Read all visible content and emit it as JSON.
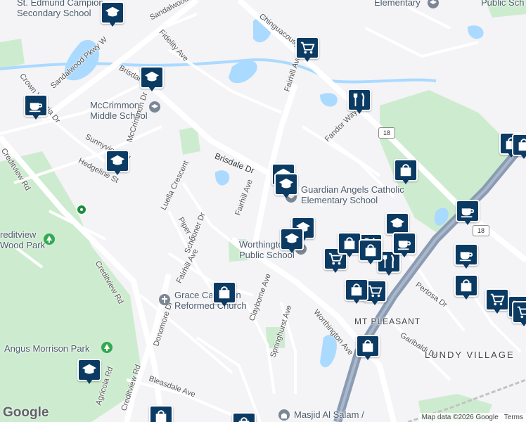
{
  "map": {
    "attribution": "Map data ©2026 Google",
    "links": [
      "Terms"
    ],
    "logo": "Google",
    "colors": {
      "background": "#f4f3f6",
      "park": "#cdeccf",
      "water": "#aadaff",
      "highway": "#8a9bb2",
      "marker": "#0b3a63"
    },
    "places": [
      {
        "text": "McCrimmon Middle School",
        "lines": [
          "McCrimmon",
          "Middle School"
        ]
      },
      {
        "text": "Guardian Angels Catholic Elementary School",
        "lines": [
          "Guardian Angels Catholic",
          "Elementary School"
        ]
      },
      {
        "text": "Worthington Public School",
        "lines": [
          "Worthington",
          "Public School"
        ]
      },
      {
        "text": "Grace Canadian Reformed Church",
        "lines": [
          "Grace Canadian",
          "Reformed Church"
        ]
      },
      {
        "text": "Angus Morrison Park",
        "lines": [
          "Angus Morrison Park"
        ]
      },
      {
        "text": "Creditview Wood Park",
        "lines": [
          "reditview",
          "Wood Park"
        ]
      },
      {
        "text": "St. Edmund Campion Secondary School",
        "lines": [
          "St. Edmund Campion",
          "Secondary School"
        ]
      },
      {
        "text": "Elementary",
        "lines": [
          "Elementary"
        ]
      },
      {
        "text": "Public Sch",
        "lines": [
          "Public Sch"
        ]
      },
      {
        "text": "Masjid Al Salam",
        "lines": [
          "Masjid Al Salam /"
        ]
      }
    ],
    "roads": [
      "Sandalwood Pkwy W",
      "Sandalwood",
      "Brisdale",
      "Brisdale Dr",
      "Chinguacousy Rd",
      "Fidelity Ave",
      "Crown Victoria Dr",
      "Sunnyview Rd",
      "McCrimmon Dr",
      "Hedgeline St",
      "Creditview Rd",
      "Luella Crescent",
      "Piper St",
      "Schooner Dr",
      "Fairhill Ave",
      "Fandor Way",
      "Claybome Ave",
      "Springhurst Ave",
      "Worthington Ave",
      "Donomore Dr",
      "Bleasdale Ave",
      "Agricola Rd",
      "Pertosa Dr",
      "Garibaldi Dr"
    ],
    "neighbourhoods": [
      "MT PLEASANT",
      "LUNDY VILLAGE"
    ],
    "highway_shields": [
      "18",
      "18"
    ],
    "markers": [
      {
        "type": "school"
      },
      {
        "type": "school"
      },
      {
        "type": "school"
      },
      {
        "type": "school"
      },
      {
        "type": "school"
      },
      {
        "type": "school"
      },
      {
        "type": "school"
      },
      {
        "type": "school"
      },
      {
        "type": "school"
      },
      {
        "type": "grocery"
      },
      {
        "type": "grocery"
      },
      {
        "type": "grocery"
      },
      {
        "type": "grocery"
      },
      {
        "type": "grocery"
      },
      {
        "type": "grocery"
      },
      {
        "type": "restaurant"
      },
      {
        "type": "restaurant"
      },
      {
        "type": "restaurant"
      },
      {
        "type": "cafe"
      },
      {
        "type": "cafe"
      },
      {
        "type": "cafe"
      },
      {
        "type": "cafe"
      },
      {
        "type": "shopping"
      },
      {
        "type": "shopping"
      },
      {
        "type": "shopping"
      },
      {
        "type": "shopping"
      },
      {
        "type": "shopping"
      },
      {
        "type": "shopping"
      },
      {
        "type": "shopping"
      },
      {
        "type": "shopping"
      },
      {
        "type": "shopping"
      },
      {
        "type": "shopping"
      },
      {
        "type": "shopping"
      }
    ]
  }
}
